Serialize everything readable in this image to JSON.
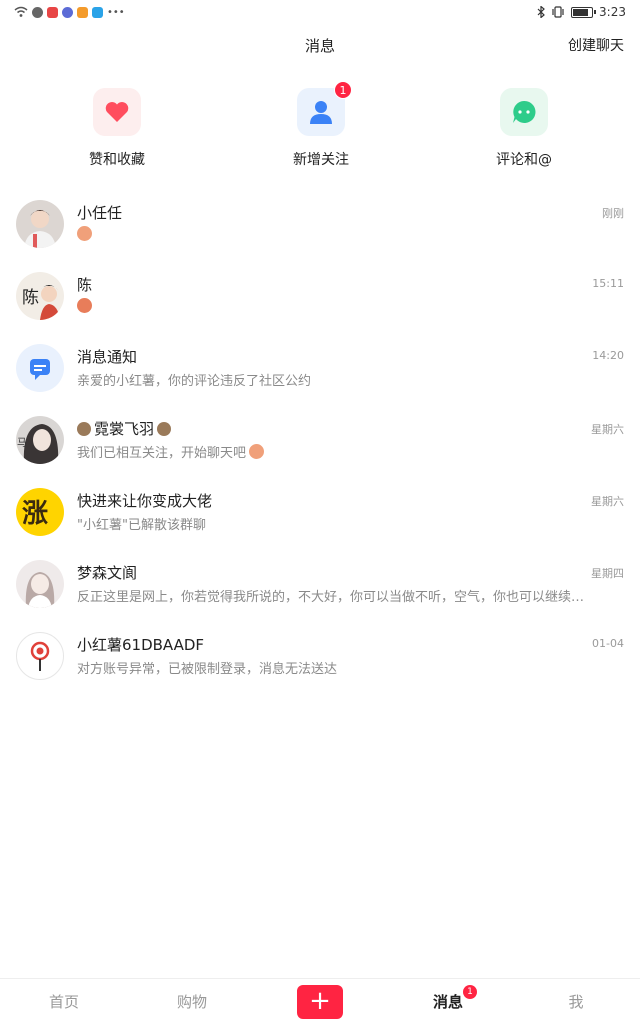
{
  "status_bar": {
    "time": "3:23",
    "battery_level": 0.75
  },
  "header": {
    "title": "消息",
    "create_chat": "创建聊天"
  },
  "shortcuts": [
    {
      "label": "赞和收藏",
      "icon": "heart-icon",
      "color": "#ff4d5e",
      "bg": "#fdeeee"
    },
    {
      "label": "新增关注",
      "icon": "person-icon",
      "color": "#3b82f6",
      "bg": "#eaf2fd",
      "badge": "1"
    },
    {
      "label": "评论和@",
      "icon": "chat-bubble-icon",
      "color": "#2ecc8a",
      "bg": "#e8f8ef"
    }
  ],
  "messages": [
    {
      "name": "小任任",
      "preview": "",
      "time": "刚刚",
      "avatar": "photo-avatar"
    },
    {
      "name": "陈",
      "preview": "",
      "time": "15:11",
      "avatar": "photo-avatar"
    },
    {
      "name": "消息通知",
      "preview": "亲爱的小红薯，你的评论违反了社区公约",
      "time": "14:20",
      "avatar": "notification-icon"
    },
    {
      "name": "霓裳飞羽",
      "preview": "我们已相互关注，开始聊天吧",
      "time": "星期六",
      "avatar": "photo-avatar"
    },
    {
      "name": "快进来让你变成大佬",
      "preview": "\"小红薯\"已解散该群聊",
      "time": "星期六",
      "avatar": "group-avatar"
    },
    {
      "name": "梦森文阆",
      "preview": "反正这里是网上，你若觉得我所说的，不大好，你可以当做不听，空气，你也可以继续…",
      "time": "星期四",
      "avatar": "photo-avatar"
    },
    {
      "name": "小红薯61DBAADF",
      "preview": "对方账号异常，已被限制登录，消息无法送达",
      "time": "01-04",
      "avatar": "default-avatar"
    }
  ],
  "tabbar": {
    "home": "首页",
    "shop": "购物",
    "plus": "+",
    "messages": "消息",
    "messages_badge": "1",
    "me": "我"
  },
  "accent_color": "#ff2442"
}
